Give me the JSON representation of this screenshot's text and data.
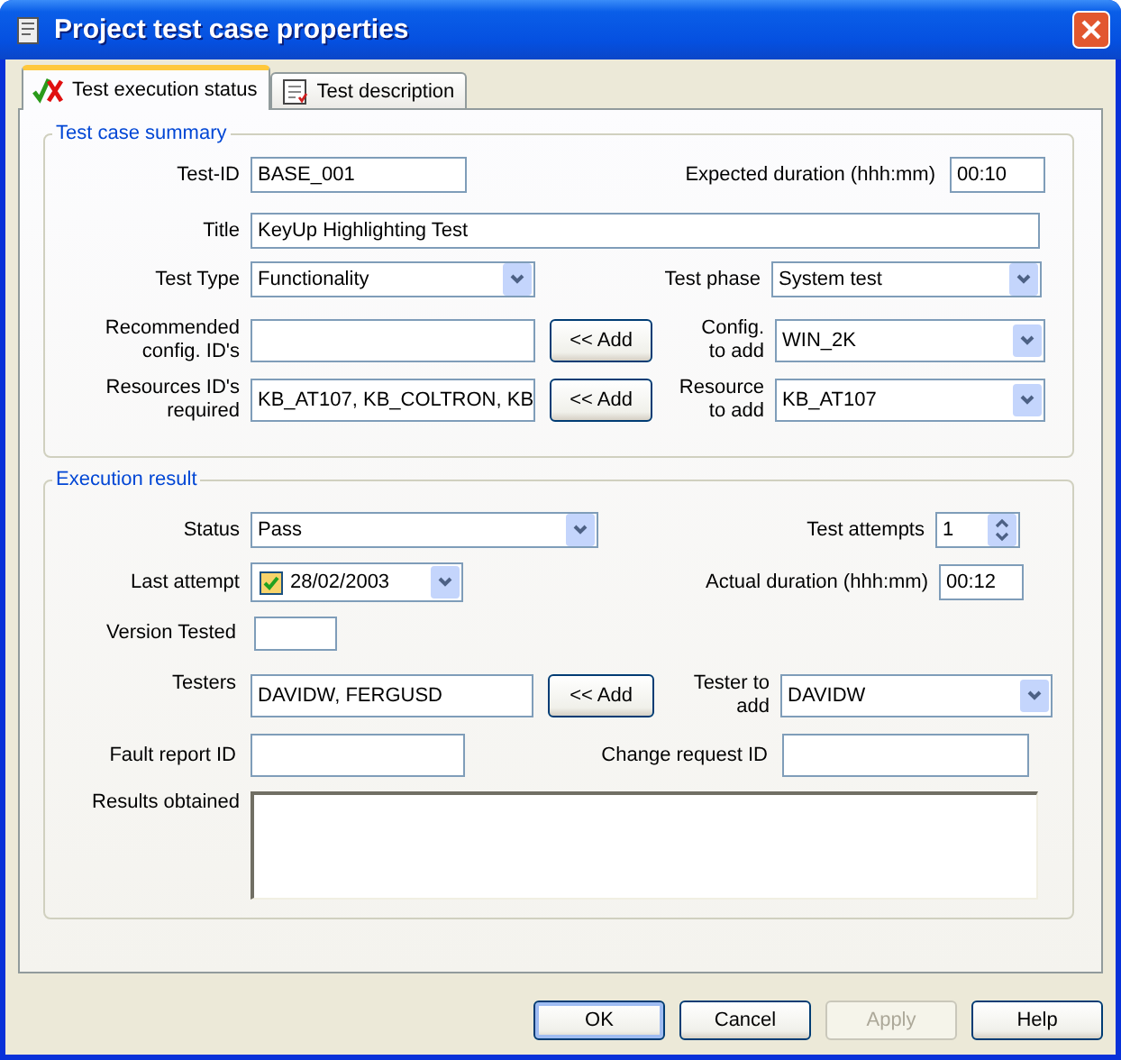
{
  "window": {
    "title": "Project test case properties"
  },
  "tabs": [
    {
      "label": "Test execution status",
      "selected": true
    },
    {
      "label": "Test description",
      "selected": false
    }
  ],
  "summary": {
    "legend": "Test case summary",
    "test_id": {
      "label": "Test-ID",
      "value": "BASE_001"
    },
    "expected_duration": {
      "label": "Expected duration (hhh:mm)",
      "value": "00:10"
    },
    "title": {
      "label": "Title",
      "value": "KeyUp Highlighting Test"
    },
    "test_type": {
      "label": "Test Type",
      "value": "Functionality"
    },
    "test_phase": {
      "label": "Test phase",
      "value": "System test"
    },
    "recommended_config": {
      "label": "Recommended\nconfig. ID's"
    },
    "add_config_button": "<< Add",
    "config_to_add": {
      "label": "Config.\nto add",
      "value": "WIN_2K"
    },
    "resources_required": {
      "label": "Resources ID's\nrequired",
      "value": "KB_AT107, KB_COLTRON, KB"
    },
    "add_resource_button": "<< Add",
    "resource_to_add": {
      "label": "Resource\nto add",
      "value": "KB_AT107"
    }
  },
  "execution": {
    "legend": "Execution result",
    "status": {
      "label": "Status",
      "value": "Pass"
    },
    "test_attempts": {
      "label": "Test attempts",
      "value": "1"
    },
    "last_attempt": {
      "label": "Last attempt",
      "value": "28/02/2003",
      "checked": true
    },
    "actual_duration": {
      "label": "Actual duration (hhh:mm)",
      "value": "00:12"
    },
    "version_tested": {
      "label": "Version Tested"
    },
    "testers": {
      "label": "Testers",
      "value": "DAVIDW, FERGUSD"
    },
    "add_tester_button": "<< Add",
    "tester_to_add": {
      "label": "Tester to\nadd",
      "value": "DAVIDW"
    },
    "fault_report": {
      "label": "Fault report ID"
    },
    "change_request": {
      "label": "Change request ID"
    },
    "results": {
      "label": "Results obtained"
    }
  },
  "buttons": [
    {
      "label": "OK",
      "disabled": false
    },
    {
      "label": "Cancel",
      "disabled": false
    },
    {
      "label": "Apply",
      "disabled": true
    },
    {
      "label": "Help",
      "disabled": false
    }
  ]
}
